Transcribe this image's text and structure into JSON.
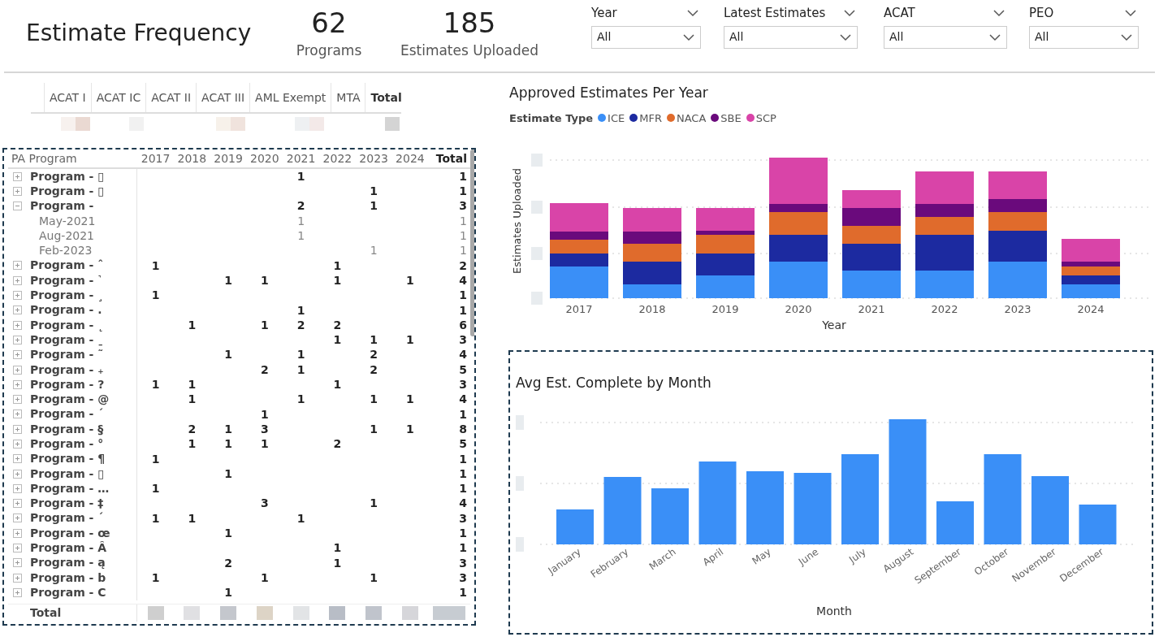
{
  "header": {
    "title": "Estimate Frequency",
    "kpis": [
      {
        "value": "62",
        "label": "Programs"
      },
      {
        "value": "185",
        "label": "Estimates Uploaded"
      }
    ],
    "slicers": [
      {
        "label": "Year",
        "value": "All"
      },
      {
        "label": "Latest Estimates",
        "value": "All"
      },
      {
        "label": "ACAT",
        "value": "All"
      },
      {
        "label": "PEO",
        "value": "All"
      }
    ]
  },
  "acat_table": {
    "columns": [
      "ACAT I",
      "ACAT IC",
      "ACAT II",
      "ACAT III",
      "AML Exempt",
      "MTA",
      "Total"
    ]
  },
  "matrix": {
    "row_header": "PA Program",
    "columns": [
      "2017",
      "2018",
      "2019",
      "2020",
      "2021",
      "2022",
      "2023",
      "2024",
      "Total"
    ],
    "rows": [
      {
        "name": "Program - ▯",
        "expanded": false,
        "cells": [
          null,
          null,
          null,
          null,
          "1",
          null,
          null,
          null,
          "1"
        ]
      },
      {
        "name": "Program - ▯",
        "expanded": false,
        "cells": [
          null,
          null,
          null,
          null,
          null,
          null,
          "1",
          null,
          "1"
        ]
      },
      {
        "name": "Program -",
        "expanded": true,
        "cells": [
          null,
          null,
          null,
          null,
          "2",
          null,
          "1",
          null,
          "3"
        ],
        "children": [
          {
            "name": "May-2021",
            "cells": [
              null,
              null,
              null,
              null,
              "1",
              null,
              null,
              null,
              "1"
            ]
          },
          {
            "name": "Aug-2021",
            "cells": [
              null,
              null,
              null,
              null,
              "1",
              null,
              null,
              null,
              "1"
            ]
          },
          {
            "name": "Feb-2023",
            "cells": [
              null,
              null,
              null,
              null,
              null,
              null,
              "1",
              null,
              "1"
            ]
          }
        ]
      },
      {
        "name": "Program - ˆ",
        "expanded": false,
        "cells": [
          "1",
          null,
          null,
          null,
          null,
          "1",
          null,
          null,
          "2"
        ]
      },
      {
        "name": "Program - ˺",
        "expanded": false,
        "cells": [
          null,
          null,
          "1",
          "1",
          null,
          "1",
          null,
          "1",
          "4"
        ]
      },
      {
        "name": "Program - ¸",
        "expanded": false,
        "cells": [
          "1",
          null,
          null,
          null,
          null,
          null,
          null,
          null,
          "1"
        ]
      },
      {
        "name": "Program - .",
        "expanded": false,
        "cells": [
          null,
          null,
          null,
          null,
          "1",
          null,
          null,
          null,
          "1"
        ]
      },
      {
        "name": "Program - ˛",
        "expanded": false,
        "cells": [
          null,
          "1",
          null,
          "1",
          "2",
          "2",
          null,
          null,
          "6"
        ]
      },
      {
        "name": "Program - ˍ",
        "expanded": false,
        "cells": [
          null,
          null,
          null,
          null,
          null,
          "1",
          "1",
          "1",
          "3"
        ]
      },
      {
        "name": "Program - ˜",
        "expanded": false,
        "cells": [
          null,
          null,
          "1",
          null,
          "1",
          null,
          "2",
          null,
          "4"
        ]
      },
      {
        "name": "Program - ₊",
        "expanded": false,
        "cells": [
          null,
          null,
          null,
          "2",
          "1",
          null,
          "2",
          null,
          "5"
        ]
      },
      {
        "name": "Program - ?",
        "expanded": false,
        "cells": [
          "1",
          "1",
          null,
          null,
          null,
          "1",
          null,
          null,
          "3"
        ]
      },
      {
        "name": "Program - @",
        "expanded": false,
        "cells": [
          null,
          "1",
          null,
          null,
          "1",
          null,
          "1",
          "1",
          "4"
        ]
      },
      {
        "name": "Program - ˊ",
        "expanded": false,
        "cells": [
          null,
          null,
          null,
          "1",
          null,
          null,
          null,
          null,
          "1"
        ]
      },
      {
        "name": "Program - §",
        "expanded": false,
        "cells": [
          null,
          "2",
          "1",
          "3",
          null,
          null,
          "1",
          "1",
          "8"
        ]
      },
      {
        "name": "Program - °",
        "expanded": false,
        "cells": [
          null,
          "1",
          "1",
          "1",
          null,
          "2",
          null,
          null,
          "5"
        ]
      },
      {
        "name": "Program - ¶",
        "expanded": false,
        "cells": [
          "1",
          null,
          null,
          null,
          null,
          null,
          null,
          null,
          "1"
        ]
      },
      {
        "name": "Program - ▯",
        "expanded": false,
        "cells": [
          null,
          null,
          "1",
          null,
          null,
          null,
          null,
          null,
          "1"
        ]
      },
      {
        "name": "Program - …",
        "expanded": false,
        "cells": [
          "1",
          null,
          null,
          null,
          null,
          null,
          null,
          null,
          "1"
        ]
      },
      {
        "name": "Program - ‡",
        "expanded": false,
        "cells": [
          null,
          null,
          null,
          "3",
          null,
          null,
          "1",
          null,
          "4"
        ]
      },
      {
        "name": "Program - ´",
        "expanded": false,
        "cells": [
          "1",
          "1",
          null,
          null,
          "1",
          null,
          null,
          null,
          "3"
        ]
      },
      {
        "name": "Program - œ",
        "expanded": false,
        "cells": [
          null,
          null,
          "1",
          null,
          null,
          null,
          null,
          null,
          "1"
        ]
      },
      {
        "name": "Program - Â",
        "expanded": false,
        "cells": [
          null,
          null,
          null,
          null,
          null,
          "1",
          null,
          null,
          "1"
        ]
      },
      {
        "name": "Program - ą",
        "expanded": false,
        "cells": [
          null,
          null,
          "2",
          null,
          null,
          "1",
          null,
          null,
          "3"
        ]
      },
      {
        "name": "Program - b",
        "expanded": false,
        "cells": [
          "1",
          null,
          null,
          "1",
          null,
          null,
          "1",
          null,
          "3"
        ]
      },
      {
        "name": "Program - C",
        "expanded": false,
        "cells": [
          null,
          null,
          "1",
          null,
          null,
          null,
          null,
          null,
          "1"
        ]
      }
    ],
    "total_label": "Total"
  },
  "approved_chart": {
    "title": "Approved Estimates Per Year",
    "legend_title": "Estimate Type",
    "legend": [
      {
        "label": "ICE",
        "color": "#3a8ff7"
      },
      {
        "label": "MFR",
        "color": "#1c2aa0"
      },
      {
        "label": "NACA",
        "color": "#e06b2c"
      },
      {
        "label": "SBE",
        "color": "#6a0a7c"
      },
      {
        "label": "SCP",
        "color": "#d944a8"
      }
    ],
    "ylabel": "Estimates Uploaded",
    "xlabel": "Year",
    "x_labels": [
      "2017",
      "2018",
      "2019",
      "2020",
      "2021",
      "2022",
      "2023",
      "2024"
    ]
  },
  "month_chart": {
    "title": "Avg Est. Complete by Month",
    "xlabel": "Month",
    "x_labels": [
      "January",
      "February",
      "March",
      "April",
      "May",
      "June",
      "July",
      "August",
      "September",
      "October",
      "November",
      "December"
    ]
  }
}
